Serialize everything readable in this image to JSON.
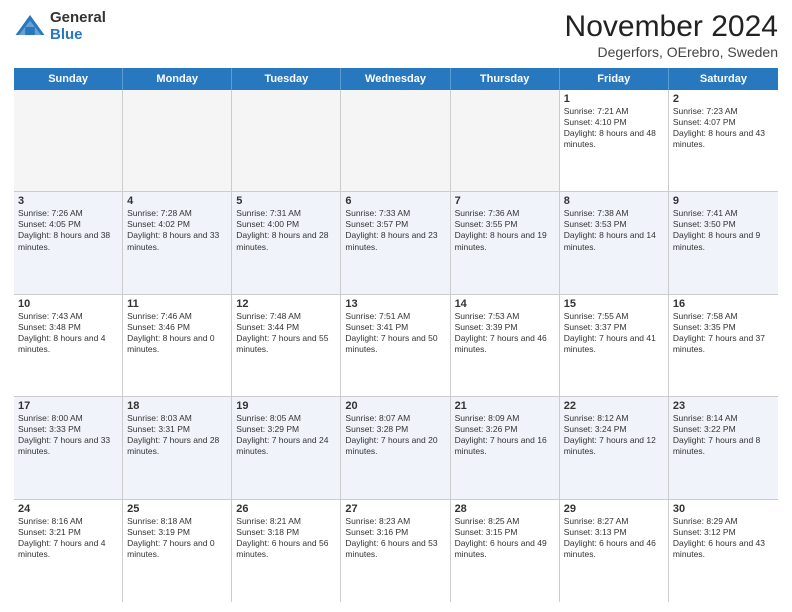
{
  "logo": {
    "general": "General",
    "blue": "Blue"
  },
  "header": {
    "month": "November 2024",
    "location": "Degerfors, OErebro, Sweden"
  },
  "weekdays": [
    "Sunday",
    "Monday",
    "Tuesday",
    "Wednesday",
    "Thursday",
    "Friday",
    "Saturday"
  ],
  "rows": [
    [
      {
        "day": "",
        "sunrise": "",
        "sunset": "",
        "daylight": "",
        "empty": true
      },
      {
        "day": "",
        "sunrise": "",
        "sunset": "",
        "daylight": "",
        "empty": true
      },
      {
        "day": "",
        "sunrise": "",
        "sunset": "",
        "daylight": "",
        "empty": true
      },
      {
        "day": "",
        "sunrise": "",
        "sunset": "",
        "daylight": "",
        "empty": true
      },
      {
        "day": "",
        "sunrise": "",
        "sunset": "",
        "daylight": "",
        "empty": true
      },
      {
        "day": "1",
        "sunrise": "Sunrise: 7:21 AM",
        "sunset": "Sunset: 4:10 PM",
        "daylight": "Daylight: 8 hours and 48 minutes."
      },
      {
        "day": "2",
        "sunrise": "Sunrise: 7:23 AM",
        "sunset": "Sunset: 4:07 PM",
        "daylight": "Daylight: 8 hours and 43 minutes."
      }
    ],
    [
      {
        "day": "3",
        "sunrise": "Sunrise: 7:26 AM",
        "sunset": "Sunset: 4:05 PM",
        "daylight": "Daylight: 8 hours and 38 minutes."
      },
      {
        "day": "4",
        "sunrise": "Sunrise: 7:28 AM",
        "sunset": "Sunset: 4:02 PM",
        "daylight": "Daylight: 8 hours and 33 minutes."
      },
      {
        "day": "5",
        "sunrise": "Sunrise: 7:31 AM",
        "sunset": "Sunset: 4:00 PM",
        "daylight": "Daylight: 8 hours and 28 minutes."
      },
      {
        "day": "6",
        "sunrise": "Sunrise: 7:33 AM",
        "sunset": "Sunset: 3:57 PM",
        "daylight": "Daylight: 8 hours and 23 minutes."
      },
      {
        "day": "7",
        "sunrise": "Sunrise: 7:36 AM",
        "sunset": "Sunset: 3:55 PM",
        "daylight": "Daylight: 8 hours and 19 minutes."
      },
      {
        "day": "8",
        "sunrise": "Sunrise: 7:38 AM",
        "sunset": "Sunset: 3:53 PM",
        "daylight": "Daylight: 8 hours and 14 minutes."
      },
      {
        "day": "9",
        "sunrise": "Sunrise: 7:41 AM",
        "sunset": "Sunset: 3:50 PM",
        "daylight": "Daylight: 8 hours and 9 minutes."
      }
    ],
    [
      {
        "day": "10",
        "sunrise": "Sunrise: 7:43 AM",
        "sunset": "Sunset: 3:48 PM",
        "daylight": "Daylight: 8 hours and 4 minutes."
      },
      {
        "day": "11",
        "sunrise": "Sunrise: 7:46 AM",
        "sunset": "Sunset: 3:46 PM",
        "daylight": "Daylight: 8 hours and 0 minutes."
      },
      {
        "day": "12",
        "sunrise": "Sunrise: 7:48 AM",
        "sunset": "Sunset: 3:44 PM",
        "daylight": "Daylight: 7 hours and 55 minutes."
      },
      {
        "day": "13",
        "sunrise": "Sunrise: 7:51 AM",
        "sunset": "Sunset: 3:41 PM",
        "daylight": "Daylight: 7 hours and 50 minutes."
      },
      {
        "day": "14",
        "sunrise": "Sunrise: 7:53 AM",
        "sunset": "Sunset: 3:39 PM",
        "daylight": "Daylight: 7 hours and 46 minutes."
      },
      {
        "day": "15",
        "sunrise": "Sunrise: 7:55 AM",
        "sunset": "Sunset: 3:37 PM",
        "daylight": "Daylight: 7 hours and 41 minutes."
      },
      {
        "day": "16",
        "sunrise": "Sunrise: 7:58 AM",
        "sunset": "Sunset: 3:35 PM",
        "daylight": "Daylight: 7 hours and 37 minutes."
      }
    ],
    [
      {
        "day": "17",
        "sunrise": "Sunrise: 8:00 AM",
        "sunset": "Sunset: 3:33 PM",
        "daylight": "Daylight: 7 hours and 33 minutes."
      },
      {
        "day": "18",
        "sunrise": "Sunrise: 8:03 AM",
        "sunset": "Sunset: 3:31 PM",
        "daylight": "Daylight: 7 hours and 28 minutes."
      },
      {
        "day": "19",
        "sunrise": "Sunrise: 8:05 AM",
        "sunset": "Sunset: 3:29 PM",
        "daylight": "Daylight: 7 hours and 24 minutes."
      },
      {
        "day": "20",
        "sunrise": "Sunrise: 8:07 AM",
        "sunset": "Sunset: 3:28 PM",
        "daylight": "Daylight: 7 hours and 20 minutes."
      },
      {
        "day": "21",
        "sunrise": "Sunrise: 8:09 AM",
        "sunset": "Sunset: 3:26 PM",
        "daylight": "Daylight: 7 hours and 16 minutes."
      },
      {
        "day": "22",
        "sunrise": "Sunrise: 8:12 AM",
        "sunset": "Sunset: 3:24 PM",
        "daylight": "Daylight: 7 hours and 12 minutes."
      },
      {
        "day": "23",
        "sunrise": "Sunrise: 8:14 AM",
        "sunset": "Sunset: 3:22 PM",
        "daylight": "Daylight: 7 hours and 8 minutes."
      }
    ],
    [
      {
        "day": "24",
        "sunrise": "Sunrise: 8:16 AM",
        "sunset": "Sunset: 3:21 PM",
        "daylight": "Daylight: 7 hours and 4 minutes."
      },
      {
        "day": "25",
        "sunrise": "Sunrise: 8:18 AM",
        "sunset": "Sunset: 3:19 PM",
        "daylight": "Daylight: 7 hours and 0 minutes."
      },
      {
        "day": "26",
        "sunrise": "Sunrise: 8:21 AM",
        "sunset": "Sunset: 3:18 PM",
        "daylight": "Daylight: 6 hours and 56 minutes."
      },
      {
        "day": "27",
        "sunrise": "Sunrise: 8:23 AM",
        "sunset": "Sunset: 3:16 PM",
        "daylight": "Daylight: 6 hours and 53 minutes."
      },
      {
        "day": "28",
        "sunrise": "Sunrise: 8:25 AM",
        "sunset": "Sunset: 3:15 PM",
        "daylight": "Daylight: 6 hours and 49 minutes."
      },
      {
        "day": "29",
        "sunrise": "Sunrise: 8:27 AM",
        "sunset": "Sunset: 3:13 PM",
        "daylight": "Daylight: 6 hours and 46 minutes."
      },
      {
        "day": "30",
        "sunrise": "Sunrise: 8:29 AM",
        "sunset": "Sunset: 3:12 PM",
        "daylight": "Daylight: 6 hours and 43 minutes."
      }
    ]
  ]
}
